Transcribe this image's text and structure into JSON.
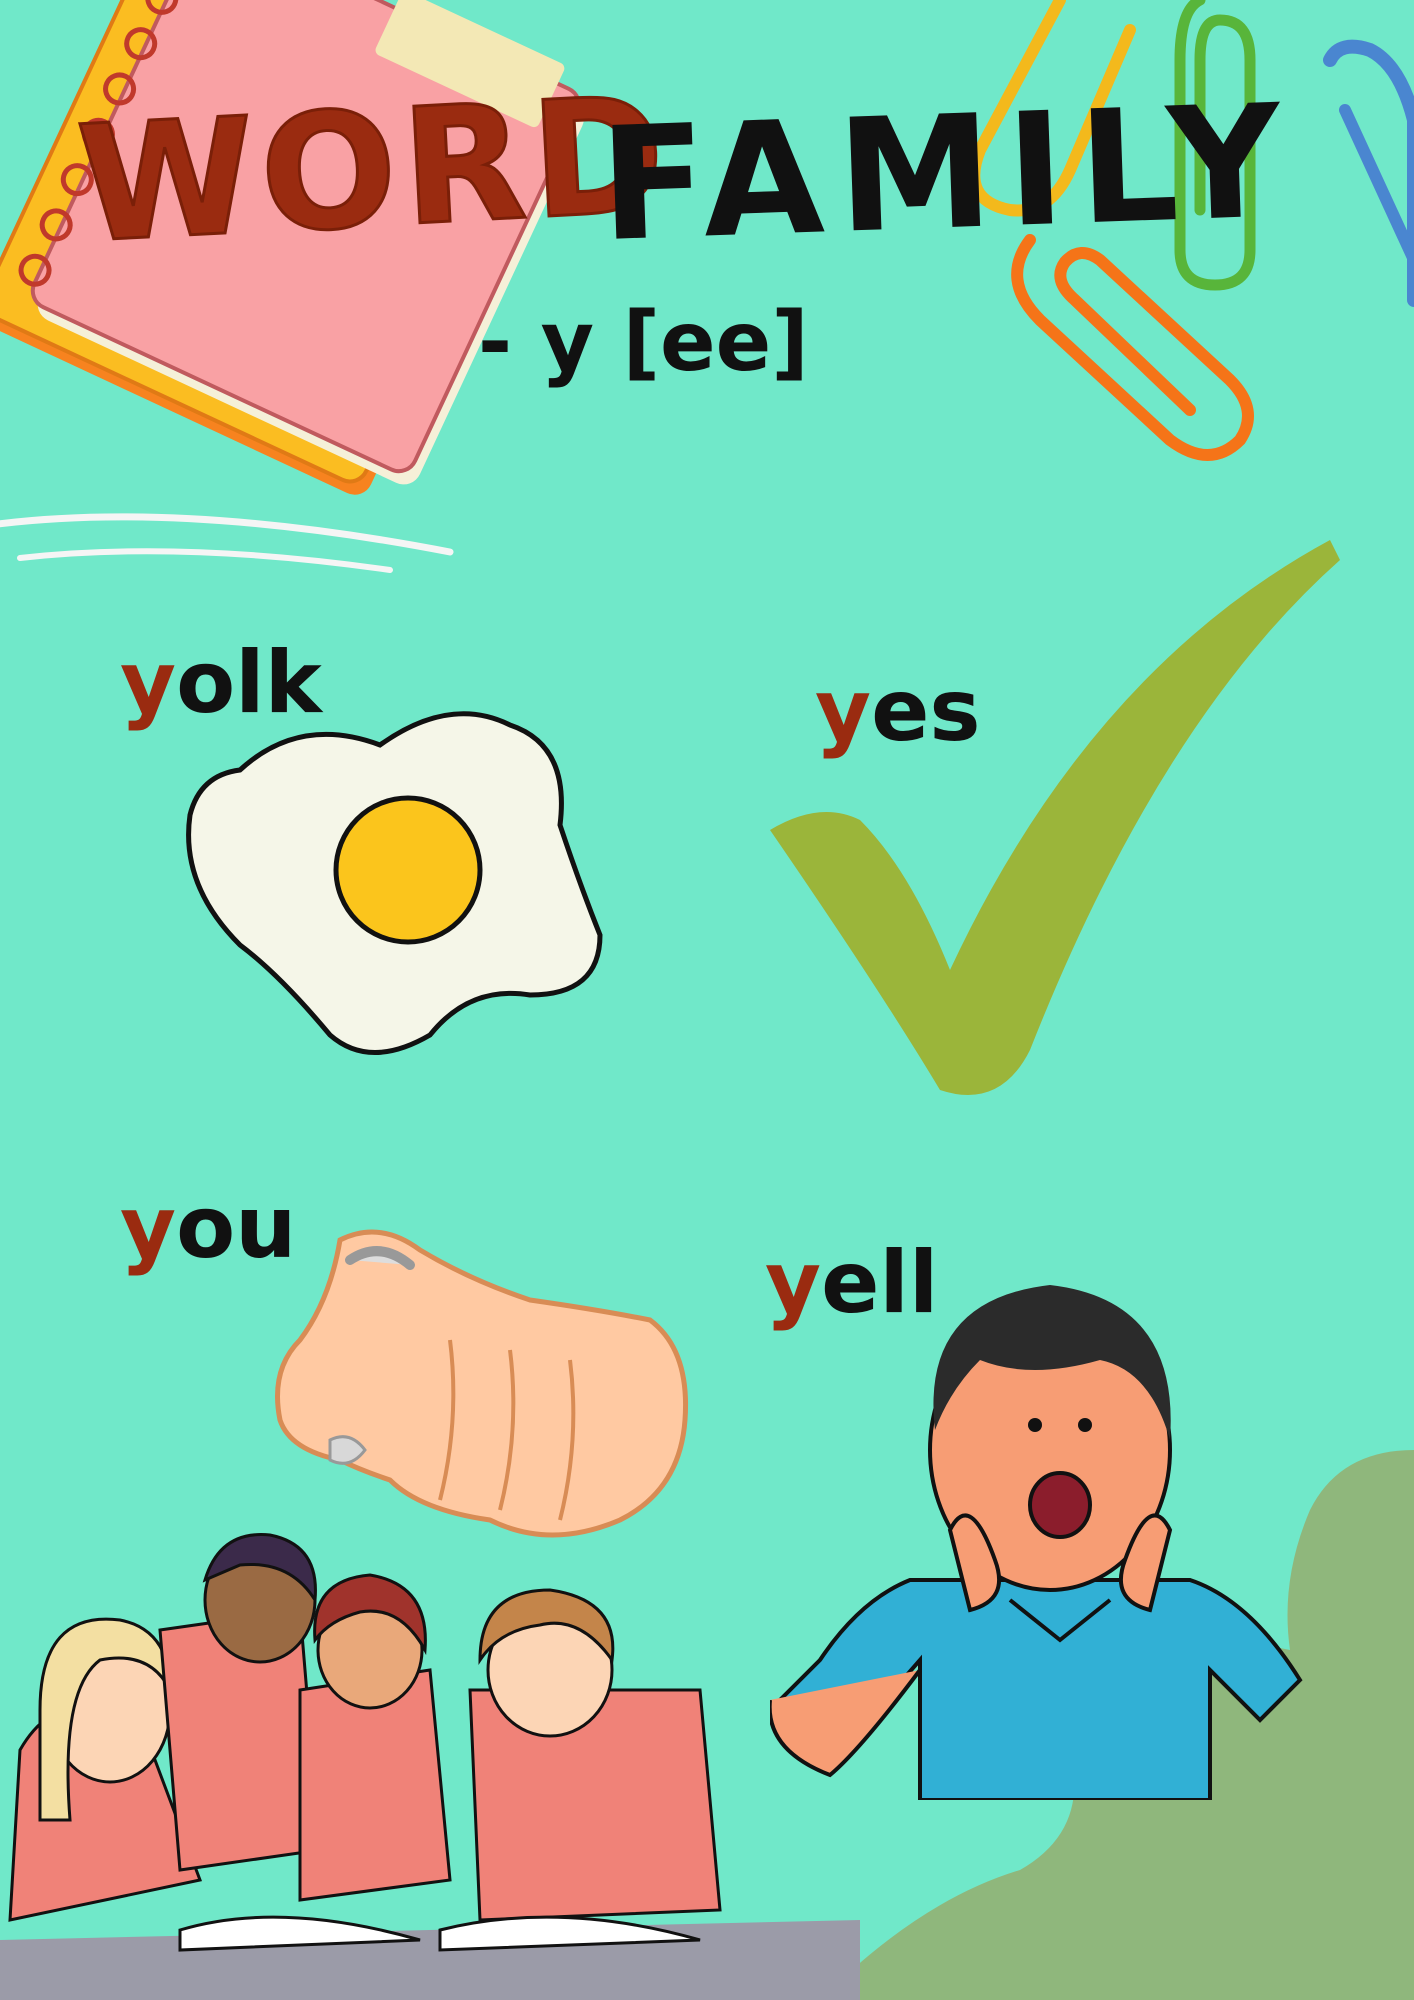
{
  "title": {
    "part1": "WORD",
    "part2": "FAMILY"
  },
  "subtitle": "- y [ee]",
  "words": [
    {
      "initial": "y",
      "rest": "olk"
    },
    {
      "initial": "y",
      "rest": "es"
    },
    {
      "initial": "y",
      "rest": "ou"
    },
    {
      "initial": "y",
      "rest": "ell"
    }
  ],
  "colors": {
    "background": "#70e8c9",
    "initial_letter": "#9a2b10",
    "title_part1": "#9a2b10",
    "checkmark": "#9bb53a",
    "blob": "#8fb77c"
  },
  "icons": [
    "notebook-icon",
    "paperclip-icon",
    "fried-egg-icon",
    "checkmark-icon",
    "pointing-hand-icon",
    "yelling-boy-icon",
    "students-icon"
  ]
}
